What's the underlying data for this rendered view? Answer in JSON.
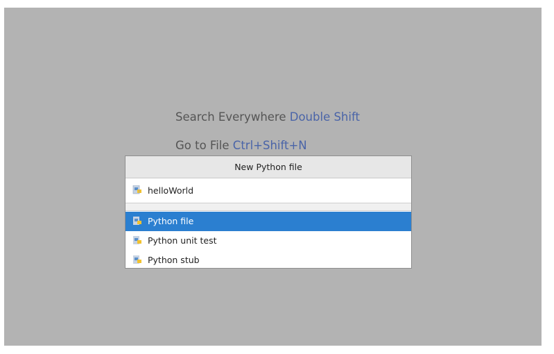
{
  "hints": [
    {
      "label": "Search Everywhere",
      "shortcut": "Double Shift"
    },
    {
      "label": "Go to File",
      "shortcut": "Ctrl+Shift+N"
    }
  ],
  "popup": {
    "title": "New Python file",
    "name_value": "helloWorld",
    "items": [
      {
        "label": "Python file",
        "selected": true
      },
      {
        "label": "Python unit test",
        "selected": false
      },
      {
        "label": "Python stub",
        "selected": false
      }
    ]
  },
  "icons": {
    "file_type": "python-file-icon"
  },
  "colors": {
    "selection": "#2b7fd0",
    "shortcut": "#4a64a8",
    "backdrop": "#b3b3b3"
  }
}
